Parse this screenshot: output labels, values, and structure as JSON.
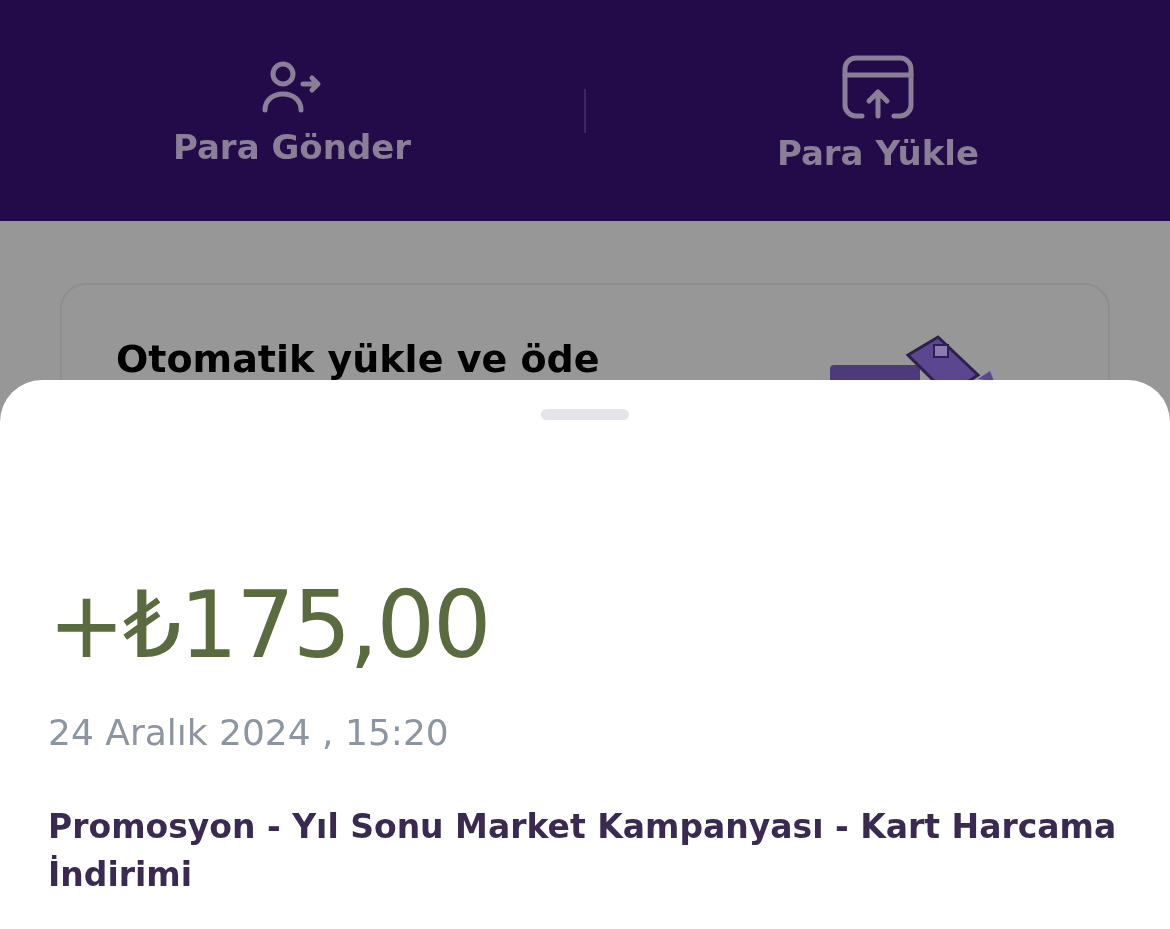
{
  "actions": [
    {
      "kind": "send",
      "label": "Para Gönder"
    },
    {
      "kind": "load",
      "label": "Para Yükle"
    }
  ],
  "promo_card": {
    "title": "Otomatik yükle ve öde"
  },
  "transaction": {
    "amount": "+₺175,00",
    "date": "24 Aralık 2024 , 15:20",
    "description": "Promosyon - Yıl Sonu Market Kampanyası - Kart Harcama İndirimi"
  }
}
